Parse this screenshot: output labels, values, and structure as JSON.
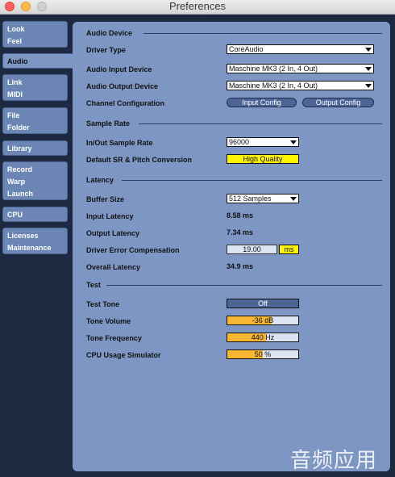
{
  "window": {
    "title": "Preferences"
  },
  "tabs": [
    {
      "id": "look-feel",
      "lines": [
        "Look",
        "Feel"
      ]
    },
    {
      "id": "audio",
      "lines": [
        "Audio"
      ]
    },
    {
      "id": "link-midi",
      "lines": [
        "Link",
        "MIDI"
      ]
    },
    {
      "id": "file-folder",
      "lines": [
        "File",
        "Folder"
      ]
    },
    {
      "id": "library",
      "lines": [
        "Library"
      ]
    },
    {
      "id": "record-warp-launch",
      "lines": [
        "Record",
        "Warp",
        "Launch"
      ]
    },
    {
      "id": "cpu",
      "lines": [
        "CPU"
      ]
    },
    {
      "id": "licenses-maintenance",
      "lines": [
        "Licenses",
        "Maintenance"
      ]
    }
  ],
  "active_tab": "Audio",
  "audio_device": {
    "header": "Audio Device",
    "driver_type_label": "Driver Type",
    "driver_type_value": "CoreAudio",
    "input_device_label": "Audio Input Device",
    "input_device_value": "Maschine MK3 (2 In, 4 Out)",
    "output_device_label": "Audio Output Device",
    "output_device_value": "Maschine MK3 (2 In, 4 Out)",
    "channel_config_label": "Channel Configuration",
    "input_config_button": "Input Config",
    "output_config_button": "Output Config"
  },
  "sample_rate": {
    "header": "Sample Rate",
    "rate_label": "In/Out Sample Rate",
    "rate_value": "96000",
    "conversion_label": "Default SR & Pitch Conversion",
    "conversion_value": "High Quality"
  },
  "latency": {
    "header": "Latency",
    "buffer_label": "Buffer Size",
    "buffer_value": "512 Samples",
    "input_latency_label": "Input Latency",
    "input_latency_value": "8.58 ms",
    "output_latency_label": "Output Latency",
    "output_latency_value": "7.34 ms",
    "comp_label": "Driver Error Compensation",
    "comp_value": "19.00",
    "comp_unit": "ms",
    "overall_label": "Overall Latency",
    "overall_value": "34.9 ms"
  },
  "test": {
    "header": "Test",
    "tone_label": "Test Tone",
    "tone_value": "Off",
    "volume_label": "Tone Volume",
    "volume_value": "-36 dB",
    "volume_fill": 0.62,
    "frequency_label": "Tone Frequency",
    "frequency_value": "440 Hz",
    "frequency_fill": 0.55,
    "cpu_label": "CPU Usage Simulator",
    "cpu_value": "50 %",
    "cpu_fill": 0.5
  },
  "colors": {
    "fill_orange": "#f7b733",
    "panel": "#7d96c3",
    "tab": "#6b86b5",
    "yellow": "#fff600"
  },
  "watermark": "音频应用"
}
